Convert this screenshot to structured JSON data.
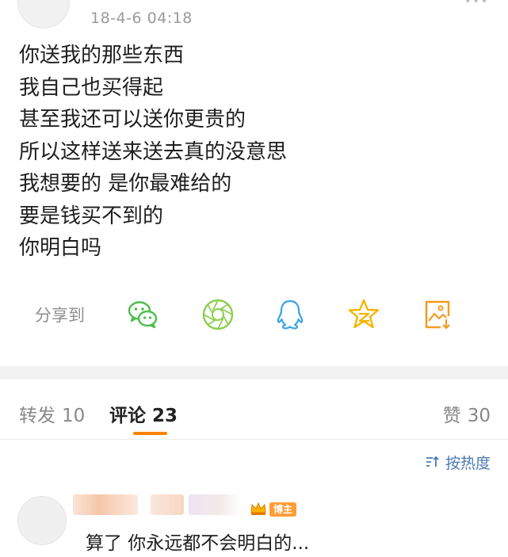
{
  "post": {
    "time": "18-4-6 04:18",
    "lines": [
      "你送我的那些东西",
      "我自己也买得起",
      "甚至我还可以送你更贵的",
      "所以这样送来送去真的没意思",
      "我想要的 是你最难给的",
      "要是钱买不到的",
      "你明白吗"
    ]
  },
  "share": {
    "label": "分享到",
    "targets": [
      {
        "name": "wechat-icon",
        "color": "#4cbf4a"
      },
      {
        "name": "moments-icon",
        "color": "#8ccf4f"
      },
      {
        "name": "qq-icon",
        "color": "#3aa3e3"
      },
      {
        "name": "qzone-icon",
        "color": "#f5b400"
      },
      {
        "name": "save-image-icon",
        "color": "#f59a1b"
      }
    ]
  },
  "tabs": {
    "repost": {
      "label": "转发",
      "count": "10"
    },
    "comment": {
      "label": "评论",
      "count": "23"
    },
    "like": {
      "label": "赞",
      "count": "30"
    }
  },
  "sort": {
    "label": "按热度"
  },
  "comments": [
    {
      "badge": "博主",
      "text": "算了 你永远都不会明白的..."
    }
  ],
  "colors": {
    "accent": "#ff8200",
    "link": "#4b7ab3",
    "badge": "#ff9d35"
  }
}
